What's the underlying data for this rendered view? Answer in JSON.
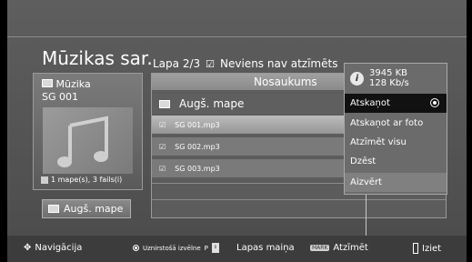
{
  "header": {
    "title": "Mūzikas sar.",
    "page_info": "Lapa 2/3",
    "mark_status": "Neviens nav atzīmēts"
  },
  "thumbnail": {
    "folder_label": "Mūzika",
    "device": "SG 001",
    "summary": "1 mape(s), 3 fails(i)"
  },
  "up_button": {
    "label": "Augš. mape"
  },
  "list": {
    "column_header": "Nosaukums",
    "up_row": "Augš. mape",
    "files": [
      "SG 001.mp3",
      "SG 002.mp3",
      "SG 003.mp3"
    ]
  },
  "menu": {
    "info_size": "3945 KB",
    "info_rate": "128 Kb/s",
    "items": [
      "Atskaņot",
      "Atskaņot ar foto",
      "Atzīmēt visu",
      "Dzēst",
      "Aizvērt"
    ],
    "selected_index": 0
  },
  "bottom": {
    "nav": "Navigācija",
    "options": "Uznirstošā izvēlne",
    "page_key": "P",
    "page_change": "Lapas maiņa",
    "mark_key": "MARK",
    "mark": "Atzīmēt",
    "exit": "Iziet"
  }
}
